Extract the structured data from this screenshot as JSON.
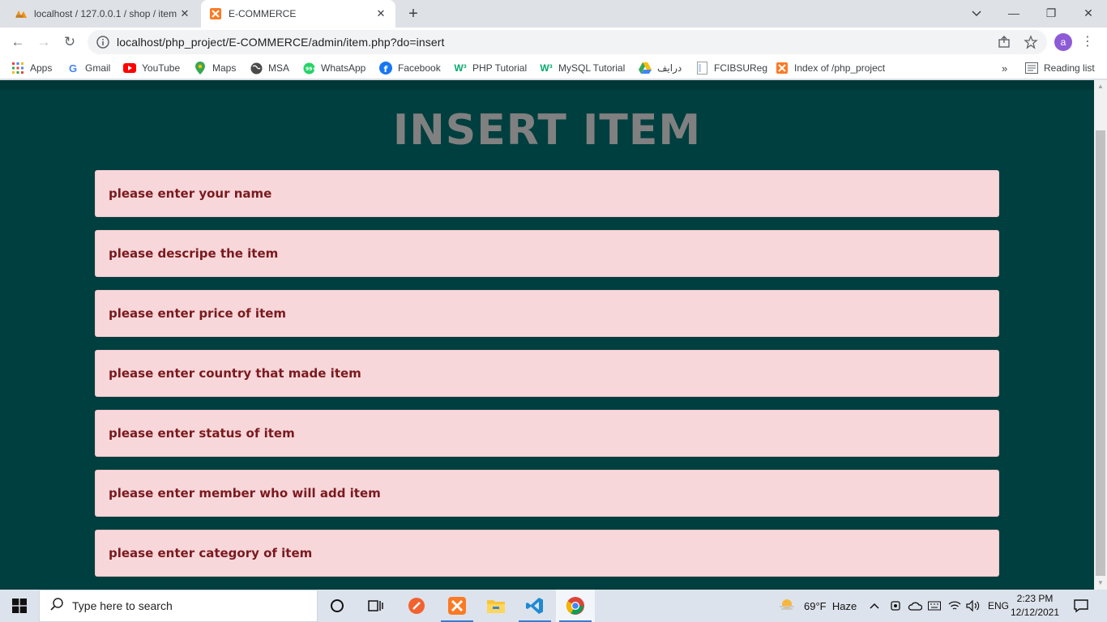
{
  "browser": {
    "tabs": [
      {
        "title": "localhost / 127.0.0.1 / shop / item",
        "favicon": "phpmyadmin-icon"
      },
      {
        "title": "E-COMMERCE",
        "favicon": "xampp-icon"
      }
    ],
    "url": "localhost/php_project/E-COMMERCE/admin/item.php?do=insert",
    "profile_initial": "a",
    "bookmarks": [
      {
        "label": "Apps",
        "icon": "apps-grid-icon"
      },
      {
        "label": "Gmail",
        "icon": "google-icon"
      },
      {
        "label": "YouTube",
        "icon": "youtube-icon"
      },
      {
        "label": "Maps",
        "icon": "maps-icon"
      },
      {
        "label": "MSA",
        "icon": "globe-icon"
      },
      {
        "label": "WhatsApp",
        "icon": "whatsapp-icon"
      },
      {
        "label": "Facebook",
        "icon": "facebook-icon"
      },
      {
        "label": "PHP Tutorial",
        "icon": "w3schools-icon"
      },
      {
        "label": "MySQL Tutorial",
        "icon": "w3schools-icon"
      },
      {
        "label": "درايف",
        "icon": "drive-icon"
      },
      {
        "label": "FCIBSUReg",
        "icon": "page-icon"
      },
      {
        "label": "Index of /php_project",
        "icon": "xampp-icon"
      }
    ],
    "overflow": "»",
    "reading_list": "Reading list"
  },
  "page": {
    "heading": "INSERT ITEM",
    "fields": [
      {
        "placeholder": "please enter your name"
      },
      {
        "placeholder": "please descripe the item"
      },
      {
        "placeholder": "please enter price of item"
      },
      {
        "placeholder": "please enter country that made item"
      },
      {
        "placeholder": "please enter status of item"
      },
      {
        "placeholder": "please enter member who will add item"
      },
      {
        "placeholder": "please enter category of item"
      }
    ]
  },
  "taskbar": {
    "search_placeholder": "Type here to search",
    "weather": "69°F  Haze",
    "language": "ENG",
    "time": "2:23 PM",
    "date": "12/12/2021"
  },
  "colors": {
    "page_bg": "#003f3f",
    "field_bg": "#f8d7da",
    "field_text": "#7a1a1f",
    "heading": "#808080"
  }
}
